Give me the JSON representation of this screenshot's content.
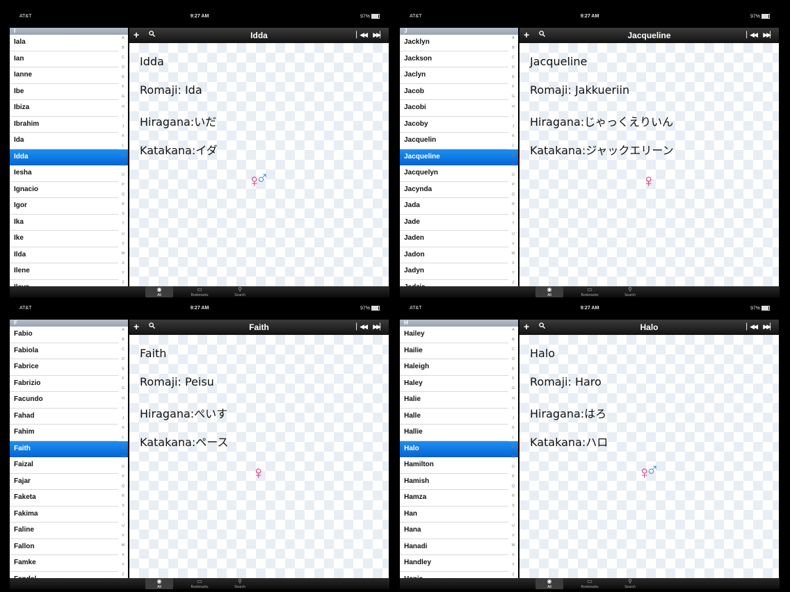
{
  "status": {
    "carrier": "AT&T",
    "time": "9:27 AM",
    "battery": "97%"
  },
  "index_letters": [
    "A",
    "B",
    "C",
    "D",
    "E",
    "F",
    "G",
    "H",
    "I",
    "J",
    "K",
    "L",
    "M",
    "N",
    "O",
    "P",
    "Q",
    "R",
    "S",
    "T",
    "U",
    "V",
    "W",
    "X",
    "Y",
    "Z"
  ],
  "tabs": [
    "All",
    "Bookmarks",
    "Search"
  ],
  "icons": {
    "add": "plus-icon",
    "search": "search-icon",
    "prev": "skip-back-icon",
    "next": "skip-forward-icon",
    "all": "globe-icon",
    "bookmarks": "book-icon",
    "tab_search": "magnifier-icon"
  },
  "colors": {
    "female": "#d4317a",
    "male": "#3b8ed8",
    "selection": "#0a72e3"
  },
  "panels": [
    {
      "section": "I",
      "names": [
        "Iala",
        "Ian",
        "Ianne",
        "Ibe",
        "Ibiza",
        "Ibrahim",
        "Ida",
        "Idda",
        "Iesha",
        "Ignacio",
        "Igor",
        "Ika",
        "Ike",
        "Ilda",
        "Ilene",
        "Ileva"
      ],
      "selected": 7,
      "title": "Idda",
      "name": "Idda",
      "romaji": "Romaji: Ida",
      "hiragana": "Hiragana:いだ",
      "katakana": "Katakana:イダ",
      "gender": "unisex"
    },
    {
      "section": "J",
      "names": [
        "Jacklyn",
        "Jackson",
        "Jaclyn",
        "Jacob",
        "Jacobi",
        "Jacoby",
        "Jacquelin",
        "Jacqueline",
        "Jacquelyn",
        "Jacynda",
        "Jada",
        "Jade",
        "Jaden",
        "Jadon",
        "Jadyn",
        "Jadzia"
      ],
      "selected": 7,
      "title": "Jacqueline",
      "name": "Jacqueline",
      "romaji": "Romaji: Jakkueriin",
      "hiragana": "Hiragana:じゃっくえりいん",
      "katakana": "Katakana:ジャックエリーン",
      "gender": "female"
    },
    {
      "section": "F",
      "names": [
        "Fabio",
        "Fabiola",
        "Fabrice",
        "Fabrizio",
        "Facundo",
        "Fahad",
        "Fahim",
        "Faith",
        "Faizal",
        "Fajar",
        "Faketa",
        "Fakima",
        "Faline",
        "Fallon",
        "Famke",
        "Fandel"
      ],
      "selected": 7,
      "title": "Faith",
      "name": "Faith",
      "romaji": "Romaji: Peisu",
      "hiragana": "Hiragana:ぺいす",
      "katakana": "Katakana:ペース",
      "gender": "female"
    },
    {
      "section": "H",
      "names": [
        "Hailey",
        "Hailie",
        "Haleigh",
        "Haley",
        "Halie",
        "Halle",
        "Hallie",
        "Halo",
        "Hamilton",
        "Hamish",
        "Hamza",
        "Han",
        "Hana",
        "Hanadi",
        "Handley",
        "Hania"
      ],
      "selected": 7,
      "title": "Halo",
      "name": "Halo",
      "romaji": "Romaji: Haro",
      "hiragana": "Hiragana:はろ",
      "katakana": "Katakana:ハロ",
      "gender": "unisex"
    }
  ]
}
